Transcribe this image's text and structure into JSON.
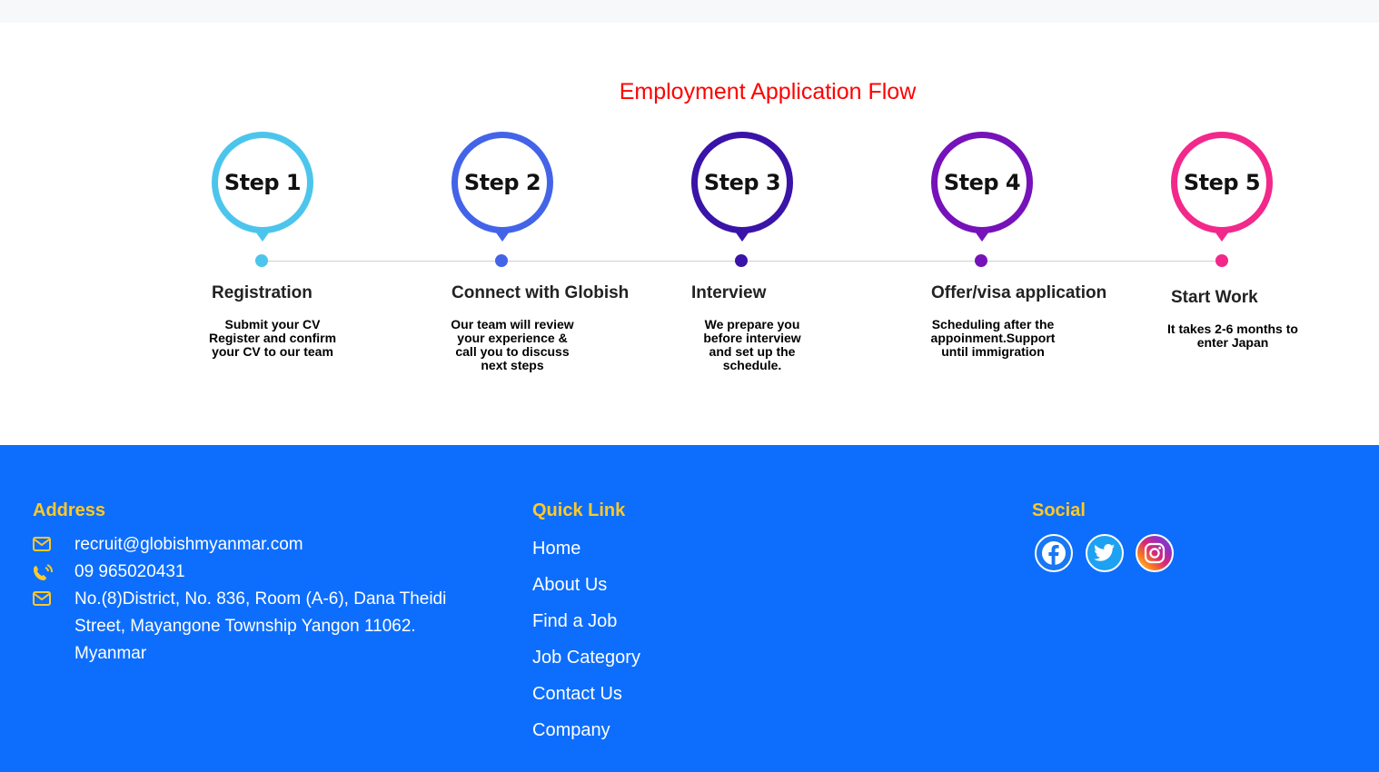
{
  "flow": {
    "title": "Employment Application Flow",
    "steps": [
      {
        "badge": "Step 1",
        "title": "Registration",
        "desc": "Submit your CV Register and confirm your CV to our team",
        "color": "#4cc5ec"
      },
      {
        "badge": "Step 2",
        "title": "Connect with Globish",
        "desc": "Our team will review your experience & call you to discuss next steps",
        "color": "#4364e8"
      },
      {
        "badge": "Step 3",
        "title": "Interview",
        "desc": "We prepare you before interview and set up the schedule.",
        "color": "#3a13a8"
      },
      {
        "badge": "Step 4",
        "title": "Offer/visa application",
        "desc": "Scheduling after the appoinment.Support until immigration",
        "color": "#7512b9"
      },
      {
        "badge": "Step 5",
        "title": "Start Work",
        "desc": "It takes 2-6 months to enter Japan",
        "color": "#f2288a"
      }
    ]
  },
  "footer": {
    "address": {
      "heading": "Address",
      "email": "recruit@globishmyanmar.com",
      "phone": "09 965020431",
      "location": "No.(8)District, No. 836, Room (A-6), Dana Theidi Street, Mayangone Township Yangon 11062. Myanmar"
    },
    "quick_links": {
      "heading": "Quick Link",
      "items": [
        "Home",
        "About Us",
        "Find a Job",
        "Job Category",
        "Contact Us",
        "Company"
      ]
    },
    "social": {
      "heading": "Social",
      "items": [
        {
          "icon": "facebook-icon"
        },
        {
          "icon": "twitter-icon"
        },
        {
          "icon": "instagram-icon"
        }
      ]
    },
    "colors": {
      "background": "#0d6efd",
      "heading": "#ffc928",
      "text": "#ffffff"
    }
  }
}
